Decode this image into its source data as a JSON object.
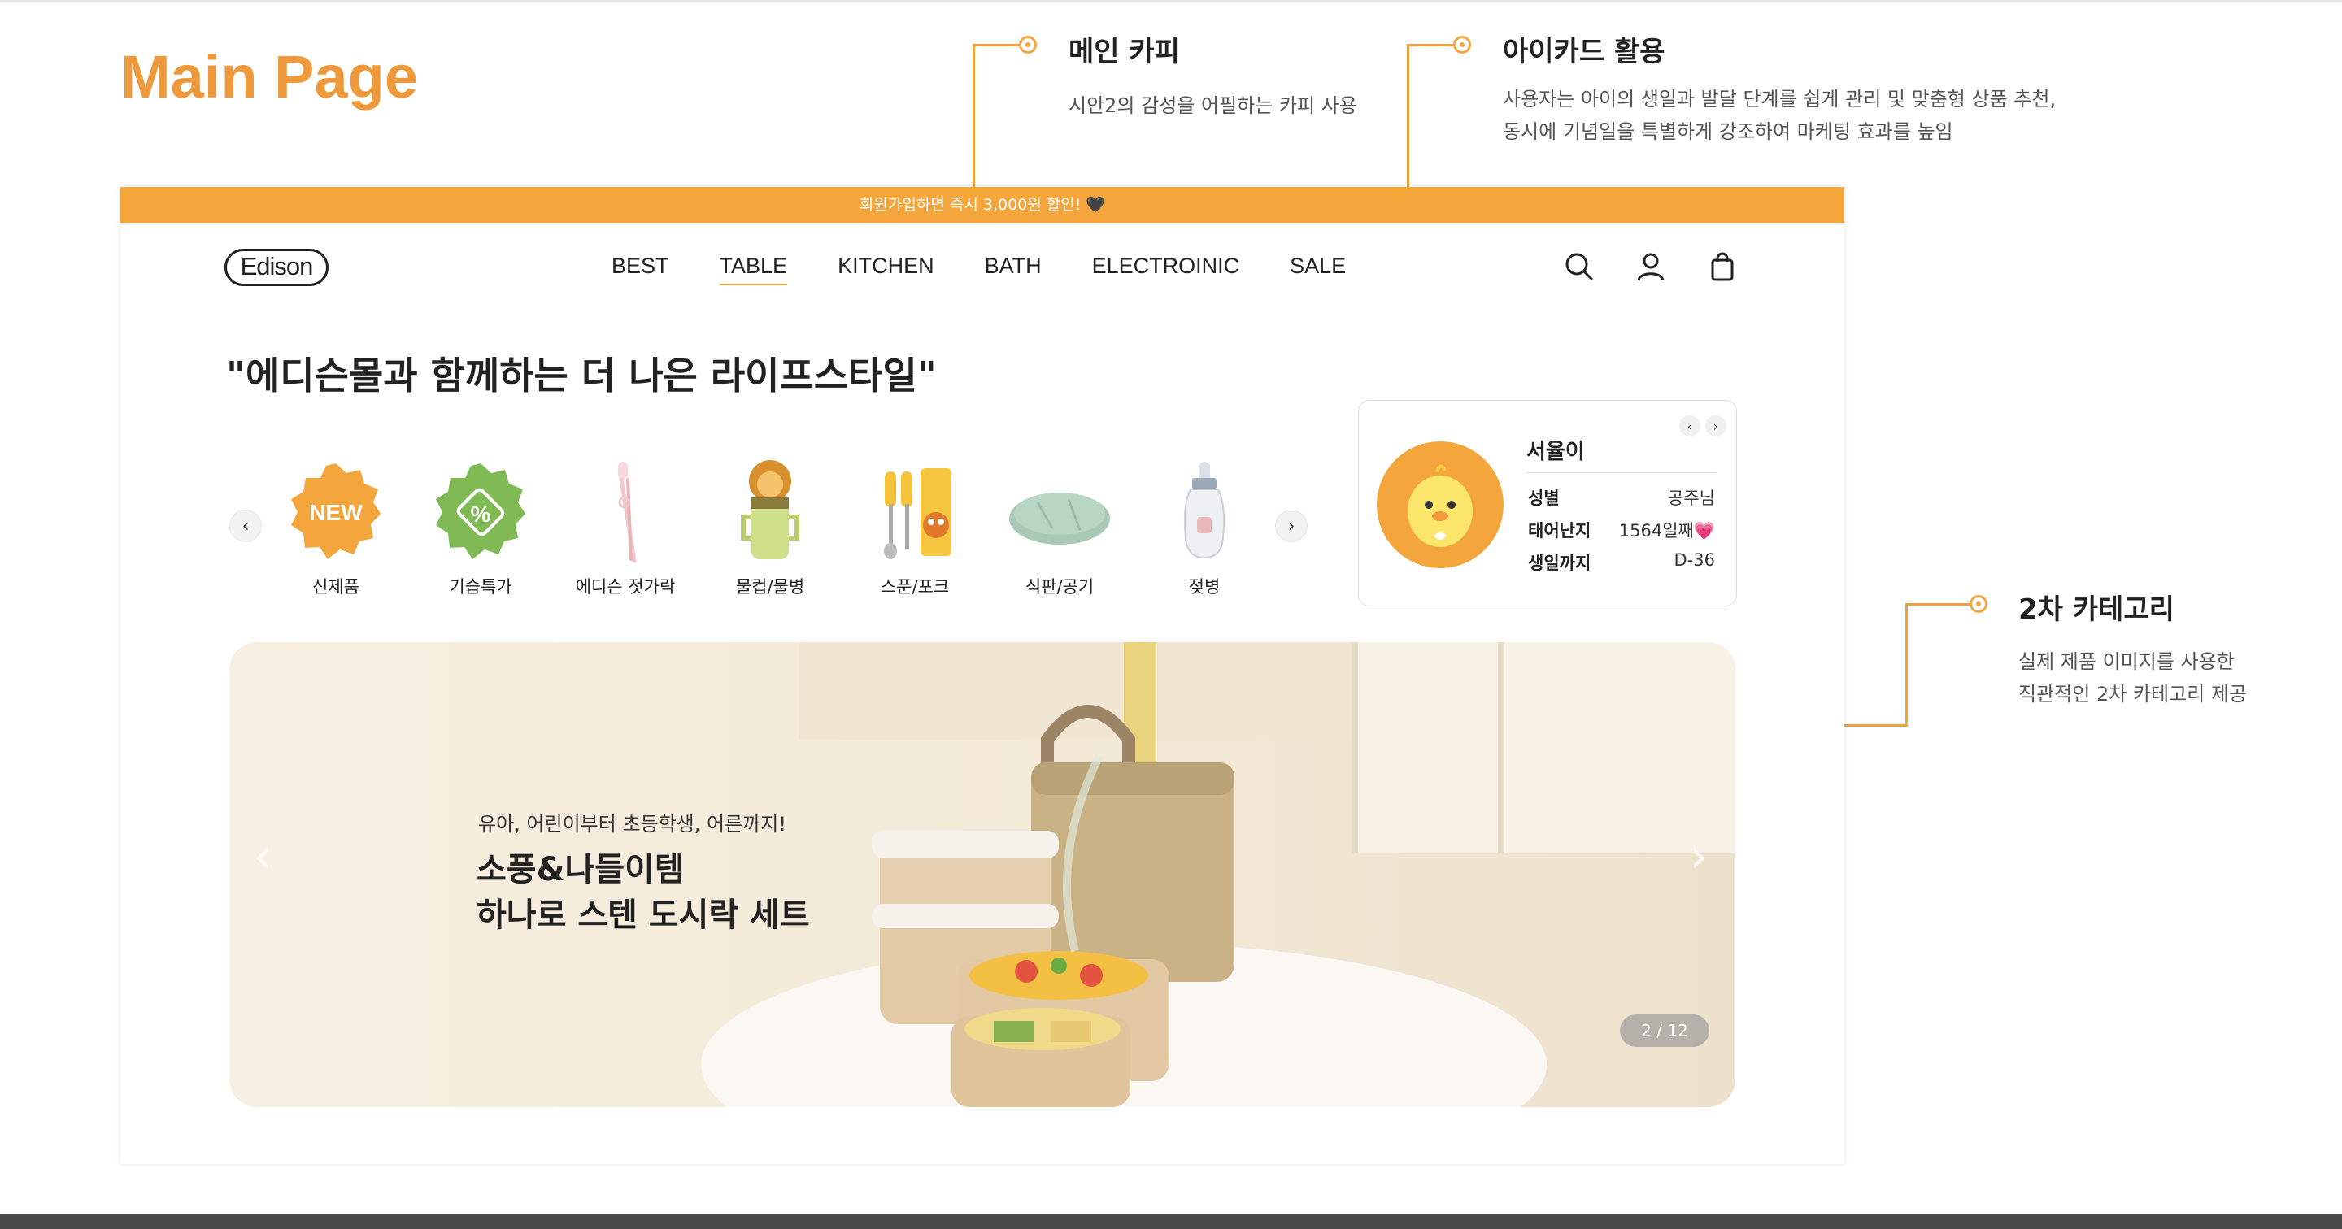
{
  "page_title": "Main Page",
  "annotations": {
    "main_copy": {
      "title": "메인 카피",
      "text": "시안2의 감성을 어필하는 카피 사용"
    },
    "id_card": {
      "title": "아이카드 활용",
      "text_line1": "사용자는 아이의 생일과 발달 단계를 쉽게 관리 및 맞춤형 상품 추천,",
      "text_line2": "동시에 기념일을 특별하게 강조하여 마케팅 효과를 높임"
    },
    "sub_category": {
      "title": "2차 카테고리",
      "text_line1": "실제 제품 이미지를 사용한",
      "text_line2": "직관적인 2차 카테고리 제공"
    }
  },
  "site": {
    "promo_banner": "회원가입하면 즉시 3,000원 할인! 🖤",
    "logo": "Edison",
    "nav": [
      "BEST",
      "TABLE",
      "KITCHEN",
      "BATH",
      "ELECTROINIC",
      "SALE"
    ],
    "nav_active": "TABLE",
    "icons": [
      "search-icon",
      "user-icon",
      "shopping-bag-icon"
    ],
    "headline": "\"에디슨몰과 함께하는 더 나은 라이프스타일\"",
    "categories": [
      {
        "label": "신제품",
        "badge": "NEW"
      },
      {
        "label": "기습특가",
        "badge": "%"
      },
      {
        "label": "에디슨 젓가락"
      },
      {
        "label": "물컵/물병"
      },
      {
        "label": "스푼/포크"
      },
      {
        "label": "식판/공기"
      },
      {
        "label": "젖병"
      }
    ],
    "id_card": {
      "name": "서율이",
      "rows": [
        {
          "key": "성별",
          "value": "공주님"
        },
        {
          "key": "태어난지",
          "value": "1564일째💗"
        },
        {
          "key": "생일까지",
          "value": "D-36"
        }
      ]
    },
    "banner": {
      "subtitle": "유아, 어린이부터 초등학생, 어른까지!",
      "title_line1": "소풍&나들이템",
      "title_line2": "하나로 스텐 도시락 세트",
      "counter": "2 / 12"
    }
  },
  "colors": {
    "accent": "#f4a63d",
    "title_orange": "#ee9a3c",
    "banner_bg": "#f4ead9"
  }
}
